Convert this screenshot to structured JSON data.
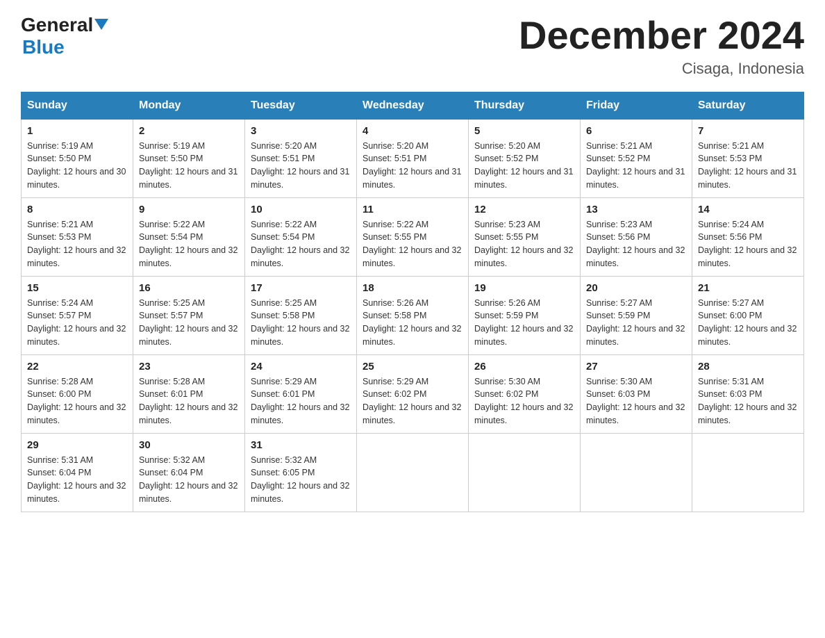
{
  "header": {
    "logo_general": "General",
    "logo_blue": "Blue",
    "title": "December 2024",
    "subtitle": "Cisaga, Indonesia"
  },
  "weekdays": [
    "Sunday",
    "Monday",
    "Tuesday",
    "Wednesday",
    "Thursday",
    "Friday",
    "Saturday"
  ],
  "weeks": [
    [
      {
        "day": "1",
        "sunrise": "5:19 AM",
        "sunset": "5:50 PM",
        "daylight": "12 hours and 30 minutes."
      },
      {
        "day": "2",
        "sunrise": "5:19 AM",
        "sunset": "5:50 PM",
        "daylight": "12 hours and 31 minutes."
      },
      {
        "day": "3",
        "sunrise": "5:20 AM",
        "sunset": "5:51 PM",
        "daylight": "12 hours and 31 minutes."
      },
      {
        "day": "4",
        "sunrise": "5:20 AM",
        "sunset": "5:51 PM",
        "daylight": "12 hours and 31 minutes."
      },
      {
        "day": "5",
        "sunrise": "5:20 AM",
        "sunset": "5:52 PM",
        "daylight": "12 hours and 31 minutes."
      },
      {
        "day": "6",
        "sunrise": "5:21 AM",
        "sunset": "5:52 PM",
        "daylight": "12 hours and 31 minutes."
      },
      {
        "day": "7",
        "sunrise": "5:21 AM",
        "sunset": "5:53 PM",
        "daylight": "12 hours and 31 minutes."
      }
    ],
    [
      {
        "day": "8",
        "sunrise": "5:21 AM",
        "sunset": "5:53 PM",
        "daylight": "12 hours and 32 minutes."
      },
      {
        "day": "9",
        "sunrise": "5:22 AM",
        "sunset": "5:54 PM",
        "daylight": "12 hours and 32 minutes."
      },
      {
        "day": "10",
        "sunrise": "5:22 AM",
        "sunset": "5:54 PM",
        "daylight": "12 hours and 32 minutes."
      },
      {
        "day": "11",
        "sunrise": "5:22 AM",
        "sunset": "5:55 PM",
        "daylight": "12 hours and 32 minutes."
      },
      {
        "day": "12",
        "sunrise": "5:23 AM",
        "sunset": "5:55 PM",
        "daylight": "12 hours and 32 minutes."
      },
      {
        "day": "13",
        "sunrise": "5:23 AM",
        "sunset": "5:56 PM",
        "daylight": "12 hours and 32 minutes."
      },
      {
        "day": "14",
        "sunrise": "5:24 AM",
        "sunset": "5:56 PM",
        "daylight": "12 hours and 32 minutes."
      }
    ],
    [
      {
        "day": "15",
        "sunrise": "5:24 AM",
        "sunset": "5:57 PM",
        "daylight": "12 hours and 32 minutes."
      },
      {
        "day": "16",
        "sunrise": "5:25 AM",
        "sunset": "5:57 PM",
        "daylight": "12 hours and 32 minutes."
      },
      {
        "day": "17",
        "sunrise": "5:25 AM",
        "sunset": "5:58 PM",
        "daylight": "12 hours and 32 minutes."
      },
      {
        "day": "18",
        "sunrise": "5:26 AM",
        "sunset": "5:58 PM",
        "daylight": "12 hours and 32 minutes."
      },
      {
        "day": "19",
        "sunrise": "5:26 AM",
        "sunset": "5:59 PM",
        "daylight": "12 hours and 32 minutes."
      },
      {
        "day": "20",
        "sunrise": "5:27 AM",
        "sunset": "5:59 PM",
        "daylight": "12 hours and 32 minutes."
      },
      {
        "day": "21",
        "sunrise": "5:27 AM",
        "sunset": "6:00 PM",
        "daylight": "12 hours and 32 minutes."
      }
    ],
    [
      {
        "day": "22",
        "sunrise": "5:28 AM",
        "sunset": "6:00 PM",
        "daylight": "12 hours and 32 minutes."
      },
      {
        "day": "23",
        "sunrise": "5:28 AM",
        "sunset": "6:01 PM",
        "daylight": "12 hours and 32 minutes."
      },
      {
        "day": "24",
        "sunrise": "5:29 AM",
        "sunset": "6:01 PM",
        "daylight": "12 hours and 32 minutes."
      },
      {
        "day": "25",
        "sunrise": "5:29 AM",
        "sunset": "6:02 PM",
        "daylight": "12 hours and 32 minutes."
      },
      {
        "day": "26",
        "sunrise": "5:30 AM",
        "sunset": "6:02 PM",
        "daylight": "12 hours and 32 minutes."
      },
      {
        "day": "27",
        "sunrise": "5:30 AM",
        "sunset": "6:03 PM",
        "daylight": "12 hours and 32 minutes."
      },
      {
        "day": "28",
        "sunrise": "5:31 AM",
        "sunset": "6:03 PM",
        "daylight": "12 hours and 32 minutes."
      }
    ],
    [
      {
        "day": "29",
        "sunrise": "5:31 AM",
        "sunset": "6:04 PM",
        "daylight": "12 hours and 32 minutes."
      },
      {
        "day": "30",
        "sunrise": "5:32 AM",
        "sunset": "6:04 PM",
        "daylight": "12 hours and 32 minutes."
      },
      {
        "day": "31",
        "sunrise": "5:32 AM",
        "sunset": "6:05 PM",
        "daylight": "12 hours and 32 minutes."
      },
      null,
      null,
      null,
      null
    ]
  ]
}
